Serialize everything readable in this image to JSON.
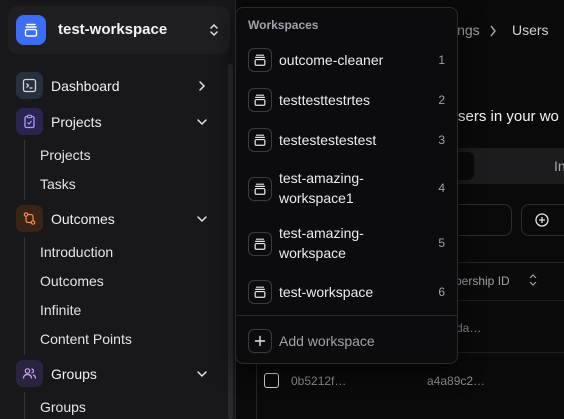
{
  "workspace": {
    "current": "test-workspace"
  },
  "sidebar": {
    "nav": [
      {
        "label": "Dashboard",
        "icon": "terminal-icon"
      },
      {
        "label": "Projects",
        "icon": "clipboard-icon"
      },
      {
        "label": "Outcomes",
        "icon": "git-branch-icon"
      },
      {
        "label": "Groups",
        "icon": "users-icon"
      }
    ],
    "projects_sub": [
      "Projects",
      "Tasks"
    ],
    "outcomes_sub": [
      "Introduction",
      "Outcomes",
      "Infinite",
      "Content Points"
    ],
    "groups_sub": [
      "Groups"
    ]
  },
  "main": {
    "breadcrumb": {
      "settings": "ings",
      "separator": ">",
      "users": "Users"
    },
    "users_heading": "sers in your wo",
    "tab_right": "In",
    "table": {
      "header_membership": "bership ID",
      "rows": [
        {
          "id": "",
          "membership": "da…"
        },
        {
          "id": "0b5212f…",
          "membership": "a4a89c2…"
        }
      ]
    }
  },
  "dropdown": {
    "title": "Workspaces",
    "items": [
      {
        "label": "outcome-cleaner",
        "shortcut": "1"
      },
      {
        "label": "testtesttestrtes",
        "shortcut": "2"
      },
      {
        "label": "testestestestest",
        "shortcut": "3"
      },
      {
        "label": "test-amazing-workspace1",
        "shortcut": "4"
      },
      {
        "label": "test-amazing-workspace",
        "shortcut": "5"
      },
      {
        "label": "test-workspace",
        "shortcut": "6"
      }
    ],
    "add_label": "Add workspace"
  },
  "colors": {
    "accent": "#3b6df6",
    "projects_icon_bg": "#2a2550",
    "outcomes_icon_bg": "#3a2416",
    "groups_icon_bg": "#2b2440"
  }
}
